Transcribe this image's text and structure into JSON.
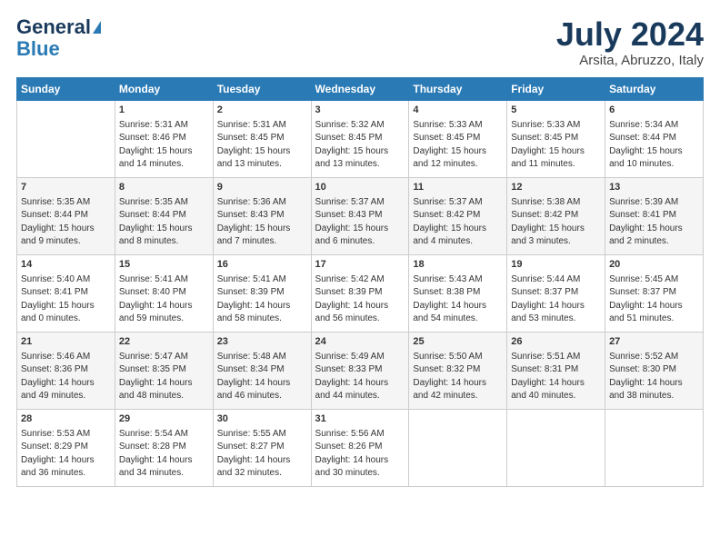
{
  "logo": {
    "line1": "General",
    "line2": "Blue"
  },
  "title": "July 2024",
  "subtitle": "Arsita, Abruzzo, Italy",
  "headers": [
    "Sunday",
    "Monday",
    "Tuesday",
    "Wednesday",
    "Thursday",
    "Friday",
    "Saturday"
  ],
  "weeks": [
    [
      {
        "day": "",
        "lines": []
      },
      {
        "day": "1",
        "lines": [
          "Sunrise: 5:31 AM",
          "Sunset: 8:46 PM",
          "Daylight: 15 hours",
          "and 14 minutes."
        ]
      },
      {
        "day": "2",
        "lines": [
          "Sunrise: 5:31 AM",
          "Sunset: 8:45 PM",
          "Daylight: 15 hours",
          "and 13 minutes."
        ]
      },
      {
        "day": "3",
        "lines": [
          "Sunrise: 5:32 AM",
          "Sunset: 8:45 PM",
          "Daylight: 15 hours",
          "and 13 minutes."
        ]
      },
      {
        "day": "4",
        "lines": [
          "Sunrise: 5:33 AM",
          "Sunset: 8:45 PM",
          "Daylight: 15 hours",
          "and 12 minutes."
        ]
      },
      {
        "day": "5",
        "lines": [
          "Sunrise: 5:33 AM",
          "Sunset: 8:45 PM",
          "Daylight: 15 hours",
          "and 11 minutes."
        ]
      },
      {
        "day": "6",
        "lines": [
          "Sunrise: 5:34 AM",
          "Sunset: 8:44 PM",
          "Daylight: 15 hours",
          "and 10 minutes."
        ]
      }
    ],
    [
      {
        "day": "7",
        "lines": [
          "Sunrise: 5:35 AM",
          "Sunset: 8:44 PM",
          "Daylight: 15 hours",
          "and 9 minutes."
        ]
      },
      {
        "day": "8",
        "lines": [
          "Sunrise: 5:35 AM",
          "Sunset: 8:44 PM",
          "Daylight: 15 hours",
          "and 8 minutes."
        ]
      },
      {
        "day": "9",
        "lines": [
          "Sunrise: 5:36 AM",
          "Sunset: 8:43 PM",
          "Daylight: 15 hours",
          "and 7 minutes."
        ]
      },
      {
        "day": "10",
        "lines": [
          "Sunrise: 5:37 AM",
          "Sunset: 8:43 PM",
          "Daylight: 15 hours",
          "and 6 minutes."
        ]
      },
      {
        "day": "11",
        "lines": [
          "Sunrise: 5:37 AM",
          "Sunset: 8:42 PM",
          "Daylight: 15 hours",
          "and 4 minutes."
        ]
      },
      {
        "day": "12",
        "lines": [
          "Sunrise: 5:38 AM",
          "Sunset: 8:42 PM",
          "Daylight: 15 hours",
          "and 3 minutes."
        ]
      },
      {
        "day": "13",
        "lines": [
          "Sunrise: 5:39 AM",
          "Sunset: 8:41 PM",
          "Daylight: 15 hours",
          "and 2 minutes."
        ]
      }
    ],
    [
      {
        "day": "14",
        "lines": [
          "Sunrise: 5:40 AM",
          "Sunset: 8:41 PM",
          "Daylight: 15 hours",
          "and 0 minutes."
        ]
      },
      {
        "day": "15",
        "lines": [
          "Sunrise: 5:41 AM",
          "Sunset: 8:40 PM",
          "Daylight: 14 hours",
          "and 59 minutes."
        ]
      },
      {
        "day": "16",
        "lines": [
          "Sunrise: 5:41 AM",
          "Sunset: 8:39 PM",
          "Daylight: 14 hours",
          "and 58 minutes."
        ]
      },
      {
        "day": "17",
        "lines": [
          "Sunrise: 5:42 AM",
          "Sunset: 8:39 PM",
          "Daylight: 14 hours",
          "and 56 minutes."
        ]
      },
      {
        "day": "18",
        "lines": [
          "Sunrise: 5:43 AM",
          "Sunset: 8:38 PM",
          "Daylight: 14 hours",
          "and 54 minutes."
        ]
      },
      {
        "day": "19",
        "lines": [
          "Sunrise: 5:44 AM",
          "Sunset: 8:37 PM",
          "Daylight: 14 hours",
          "and 53 minutes."
        ]
      },
      {
        "day": "20",
        "lines": [
          "Sunrise: 5:45 AM",
          "Sunset: 8:37 PM",
          "Daylight: 14 hours",
          "and 51 minutes."
        ]
      }
    ],
    [
      {
        "day": "21",
        "lines": [
          "Sunrise: 5:46 AM",
          "Sunset: 8:36 PM",
          "Daylight: 14 hours",
          "and 49 minutes."
        ]
      },
      {
        "day": "22",
        "lines": [
          "Sunrise: 5:47 AM",
          "Sunset: 8:35 PM",
          "Daylight: 14 hours",
          "and 48 minutes."
        ]
      },
      {
        "day": "23",
        "lines": [
          "Sunrise: 5:48 AM",
          "Sunset: 8:34 PM",
          "Daylight: 14 hours",
          "and 46 minutes."
        ]
      },
      {
        "day": "24",
        "lines": [
          "Sunrise: 5:49 AM",
          "Sunset: 8:33 PM",
          "Daylight: 14 hours",
          "and 44 minutes."
        ]
      },
      {
        "day": "25",
        "lines": [
          "Sunrise: 5:50 AM",
          "Sunset: 8:32 PM",
          "Daylight: 14 hours",
          "and 42 minutes."
        ]
      },
      {
        "day": "26",
        "lines": [
          "Sunrise: 5:51 AM",
          "Sunset: 8:31 PM",
          "Daylight: 14 hours",
          "and 40 minutes."
        ]
      },
      {
        "day": "27",
        "lines": [
          "Sunrise: 5:52 AM",
          "Sunset: 8:30 PM",
          "Daylight: 14 hours",
          "and 38 minutes."
        ]
      }
    ],
    [
      {
        "day": "28",
        "lines": [
          "Sunrise: 5:53 AM",
          "Sunset: 8:29 PM",
          "Daylight: 14 hours",
          "and 36 minutes."
        ]
      },
      {
        "day": "29",
        "lines": [
          "Sunrise: 5:54 AM",
          "Sunset: 8:28 PM",
          "Daylight: 14 hours",
          "and 34 minutes."
        ]
      },
      {
        "day": "30",
        "lines": [
          "Sunrise: 5:55 AM",
          "Sunset: 8:27 PM",
          "Daylight: 14 hours",
          "and 32 minutes."
        ]
      },
      {
        "day": "31",
        "lines": [
          "Sunrise: 5:56 AM",
          "Sunset: 8:26 PM",
          "Daylight: 14 hours",
          "and 30 minutes."
        ]
      },
      {
        "day": "",
        "lines": []
      },
      {
        "day": "",
        "lines": []
      },
      {
        "day": "",
        "lines": []
      }
    ]
  ]
}
